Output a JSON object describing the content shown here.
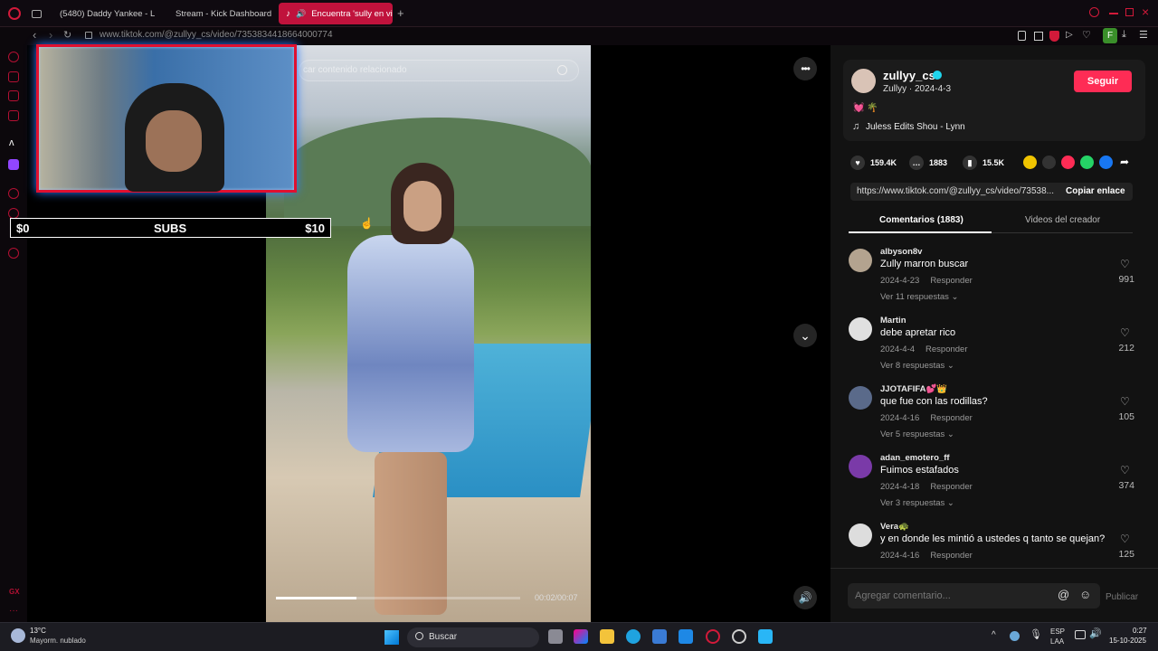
{
  "browser": {
    "tabs": [
      {
        "label": "(5480) Daddy Yankee - L"
      },
      {
        "label": "Stream - Kick Dashboard"
      },
      {
        "label": "Encuentra 'sully en vi"
      }
    ],
    "url": "www.tiktok.com/@zullyy_cs/video/7353834418664000774"
  },
  "stream_overlay": {
    "subs_left": "$0",
    "subs_label": "SUBS",
    "subs_right": "$10"
  },
  "video": {
    "search_placeholder": "car contenido relacionado",
    "time": "00:02/00:07",
    "progress": 0.33
  },
  "creator": {
    "username": "zullyy_cs",
    "subtitle": "Zullyy · 2024-4-3",
    "follow_label": "Seguir",
    "emojis": "💓 🌴",
    "music": "Juless Edits Shou - Lynn"
  },
  "stats": {
    "likes": "159.4K",
    "comments": "1883",
    "saves": "15.5K"
  },
  "link": {
    "url": "https://www.tiktok.com/@zullyy_cs/video/73538...",
    "copy_label": "Copiar enlace"
  },
  "panel_tabs": {
    "comments": "Comentarios (1883)",
    "creator_videos": "Videos del creador"
  },
  "comments": [
    {
      "user": "albyson8v",
      "text": "Zully marron buscar",
      "date": "2024-4-23",
      "reply": "Responder",
      "more": "Ver 11 respuestas ⌄",
      "likes": "991"
    },
    {
      "user": "Martin",
      "text": "debe apretar rico",
      "date": "2024-4-4",
      "reply": "Responder",
      "more": "Ver 8 respuestas ⌄",
      "likes": "212"
    },
    {
      "user": "JJOTAFIFA💕👑",
      "text": "que fue con las rodillas?",
      "date": "2024-4-16",
      "reply": "Responder",
      "more": "Ver 5 respuestas ⌄",
      "likes": "105"
    },
    {
      "user": "adan_emotero_ff",
      "text": "Fuimos estafados",
      "date": "2024-4-18",
      "reply": "Responder",
      "more": "Ver 3 respuestas ⌄",
      "likes": "374"
    },
    {
      "user": "Vera🐢",
      "text": "y en donde les mintió a ustedes q tanto se quejan?",
      "date": "2024-4-16",
      "reply": "Responder",
      "more": "",
      "likes": "125"
    }
  ],
  "composer": {
    "placeholder": "Agregar comentario...",
    "publish": "Publicar"
  },
  "taskbar": {
    "weather_temp": "13°C",
    "weather_desc": "Mayorm. nublado",
    "search": "Buscar",
    "lang1": "ESP",
    "lang2": "LAA",
    "time": "0:27",
    "date": "15-10-2025"
  },
  "colors": {
    "accent": "#fe2c55",
    "browser_accent": "#c0123c"
  }
}
